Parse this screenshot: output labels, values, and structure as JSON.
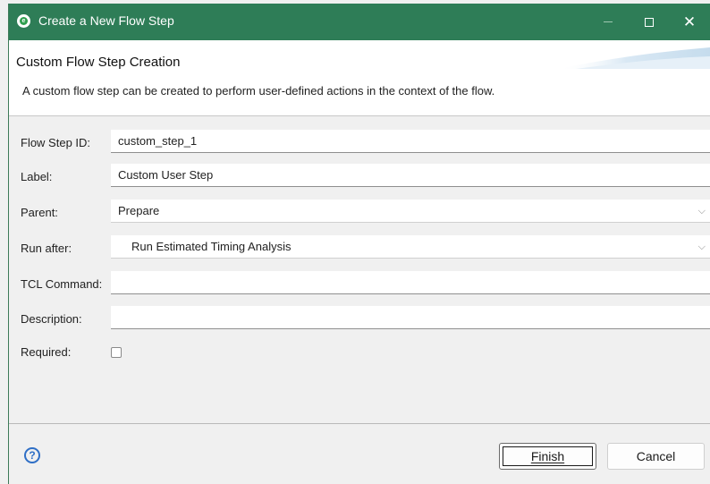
{
  "window": {
    "title": "Create a New Flow Step",
    "maximize_icon": "maximize-icon",
    "close_glyph": "✕"
  },
  "header": {
    "heading": "Custom Flow Step Creation",
    "description": "A custom flow step can be created to perform user-defined actions in the context of the flow."
  },
  "form": {
    "flow_step_id": {
      "label": "Flow Step ID:",
      "value": "custom_step_1"
    },
    "label_field": {
      "label": "Label:",
      "value": "Custom User Step"
    },
    "parent": {
      "label": "Parent:",
      "value": "Prepare"
    },
    "run_after": {
      "label": "Run after:",
      "value": "Run Estimated Timing Analysis"
    },
    "tcl_command": {
      "label": "TCL Command:",
      "value": ""
    },
    "description": {
      "label": "Description:",
      "value": ""
    },
    "required": {
      "label": "Required:",
      "checked": false
    }
  },
  "footer": {
    "help_glyph": "?",
    "finish_label": "Finish",
    "cancel_label": "Cancel"
  },
  "colors": {
    "titlebar": "#2e7d57",
    "help_accent": "#2f6fc6"
  }
}
